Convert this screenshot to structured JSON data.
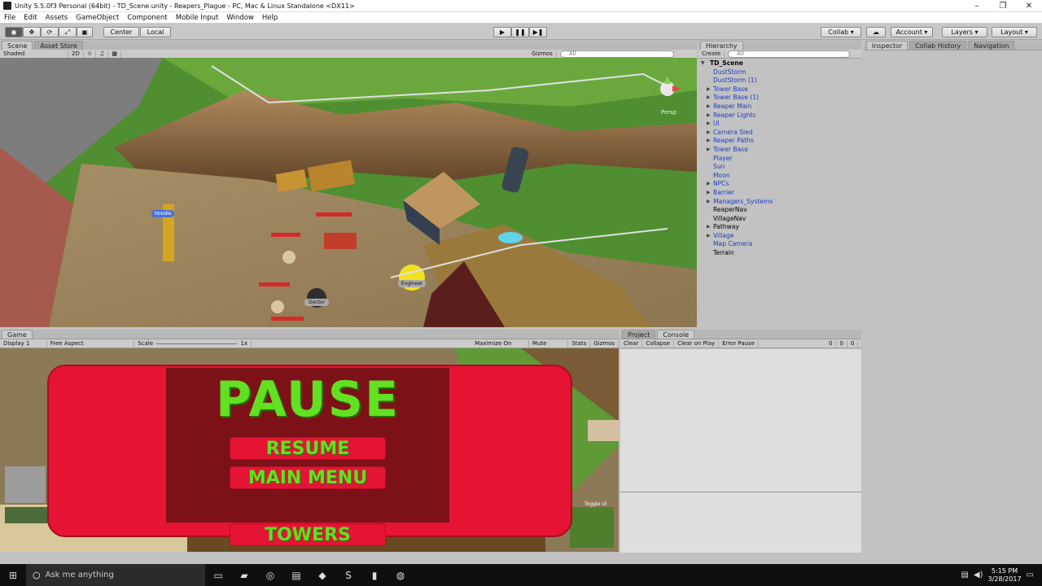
{
  "window": {
    "title": "Unity 5.5.0f3 Personal (64bit) - TD_Scene.unity - Reapers_Plague - PC, Mac & Linux Standalone <DX11>",
    "controls": [
      "–",
      "❐",
      "✕"
    ]
  },
  "menu": [
    "File",
    "Edit",
    "Assets",
    "GameObject",
    "Component",
    "Mobile Input",
    "Window",
    "Help"
  ],
  "toolbar": {
    "pivot_center": "Center",
    "pivot_local": "Local",
    "collab": "Collab ▾",
    "account": "Account",
    "layers": "Layers",
    "layout": "Layout"
  },
  "scene": {
    "tabs": [
      "Scene",
      "Asset Store"
    ],
    "shading": "Shaded",
    "mode_2d": "2D",
    "gizmos": "Gizmos",
    "search_placeholder": "All",
    "persp": "Persp",
    "labels": {
      "hoodie": "Hoodie",
      "engineer": "Engineer",
      "doctor": "Doctor"
    }
  },
  "game": {
    "tab": "Game",
    "display": "Display 1",
    "aspect": "Free Aspect",
    "scale_label": "Scale",
    "scale_value": "1x",
    "maximize": "Maximize On Play",
    "mute": "Mute Audio",
    "stats": "Stats",
    "gizmos": "Gizmos",
    "toggle_ui": "Toggle UI"
  },
  "pause_menu": {
    "title": "PAUSE",
    "resume": "RESUME",
    "main_menu": "MAIN MENU",
    "towers": "TOWERS"
  },
  "hierarchy": {
    "tab": "Hierarchy",
    "create": "Create",
    "search_placeholder": "All",
    "root": "TD_Scene",
    "items": [
      {
        "label": "DustStorm",
        "expandable": false,
        "prefab": true
      },
      {
        "label": "DustStorm (1)",
        "expandable": false,
        "prefab": true
      },
      {
        "label": "Tower Base",
        "expandable": true,
        "prefab": true
      },
      {
        "label": "Tower Base (1)",
        "expandable": true,
        "prefab": true
      },
      {
        "label": "Reaper Main",
        "expandable": true,
        "prefab": true
      },
      {
        "label": "Reaper Lights",
        "expandable": true,
        "prefab": true
      },
      {
        "label": "UI",
        "expandable": true,
        "prefab": true
      },
      {
        "label": "Camera Sled",
        "expandable": true,
        "prefab": true
      },
      {
        "label": "Reaper Paths",
        "expandable": true,
        "prefab": true
      },
      {
        "label": "Tower Base",
        "expandable": true,
        "prefab": true
      },
      {
        "label": "Player",
        "expandable": false,
        "prefab": true
      },
      {
        "label": "Sun",
        "expandable": false,
        "prefab": true
      },
      {
        "label": "Moon",
        "expandable": false,
        "prefab": true
      },
      {
        "label": "NPCs",
        "expandable": true,
        "prefab": true
      },
      {
        "label": "Barrier",
        "expandable": true,
        "prefab": true
      },
      {
        "label": "Managers_Systems",
        "expandable": true,
        "prefab": true
      },
      {
        "label": "ReaperNav",
        "expandable": false,
        "prefab": false
      },
      {
        "label": "VillageNav",
        "expandable": false,
        "prefab": false
      },
      {
        "label": "Pathway",
        "expandable": true,
        "prefab": false
      },
      {
        "label": "Village",
        "expandable": true,
        "prefab": true
      },
      {
        "label": "Map Camera",
        "expandable": false,
        "prefab": true
      },
      {
        "label": "Terrain",
        "expandable": false,
        "prefab": false
      }
    ]
  },
  "inspector": {
    "tabs": [
      "Inspector",
      "Collab History",
      "Navigation"
    ]
  },
  "console": {
    "tabs": [
      "Project",
      "Console"
    ],
    "buttons": [
      "Clear",
      "Collapse",
      "Clear on Play",
      "Error Pause"
    ],
    "counts": [
      "0",
      "0",
      "0"
    ]
  },
  "taskbar": {
    "search_placeholder": "Ask me anything",
    "time": "5:15 PM",
    "date": "3/28/2017"
  }
}
